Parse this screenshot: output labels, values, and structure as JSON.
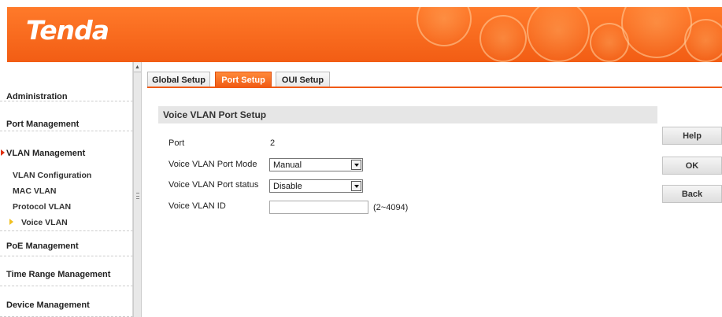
{
  "brand": {
    "logo_text": "Tenda",
    "header_color": "#f25d14"
  },
  "sidebar": {
    "items": [
      {
        "label": "Administration"
      },
      {
        "label": "Port Management"
      },
      {
        "label": "VLAN Management"
      },
      {
        "label": "PoE Management"
      },
      {
        "label": "Time Range Management"
      },
      {
        "label": "Device Management"
      }
    ],
    "vlan_subitems": [
      {
        "label": "VLAN Configuration"
      },
      {
        "label": "MAC VLAN"
      },
      {
        "label": "Protocol VLAN"
      },
      {
        "label": "Voice VLAN"
      }
    ],
    "active_item": "VLAN Management",
    "active_subitem": "Voice VLAN"
  },
  "tabs": [
    {
      "label": "Global Setup"
    },
    {
      "label": "Port Setup"
    },
    {
      "label": "OUI Setup"
    }
  ],
  "active_tab": "Port Setup",
  "form": {
    "section_title": "Voice VLAN Port Setup",
    "port_label": "Port",
    "port_value": "2",
    "mode_label": "Voice VLAN Port Mode",
    "mode_value": "Manual",
    "status_label": "Voice VLAN Port status",
    "status_value": "Disable",
    "vlan_id_label": "Voice VLAN ID",
    "vlan_id_value": "",
    "vlan_id_hint": "(2~4094)"
  },
  "buttons": {
    "help": "Help",
    "ok": "OK",
    "back": "Back"
  }
}
